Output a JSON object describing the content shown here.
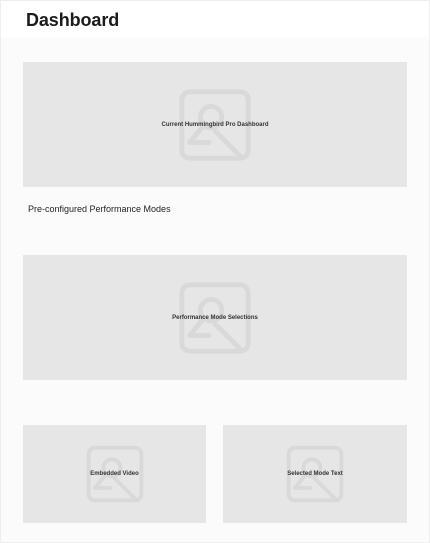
{
  "header": {
    "title": "Dashboard"
  },
  "sections": {
    "dashboard_image": {
      "label": "Current Hummingbird Pro Dashboard",
      "icon": "image-placeholder-icon"
    },
    "modes_heading": "Pre-configured Performance Modes",
    "modes_image": {
      "label": "Performance Mode Selections",
      "icon": "image-placeholder-icon"
    },
    "video": {
      "label": "Embedded Video",
      "icon": "image-placeholder-icon"
    },
    "selected_mode": {
      "label": "Selected Mode Text",
      "icon": "image-placeholder-icon"
    }
  },
  "colors": {
    "page_background": "#fbfbfb",
    "header_background": "#ffffff",
    "placeholder_background": "#e6e6e6",
    "placeholder_icon": "#d9d9d9",
    "text": "#1f1f1f"
  }
}
